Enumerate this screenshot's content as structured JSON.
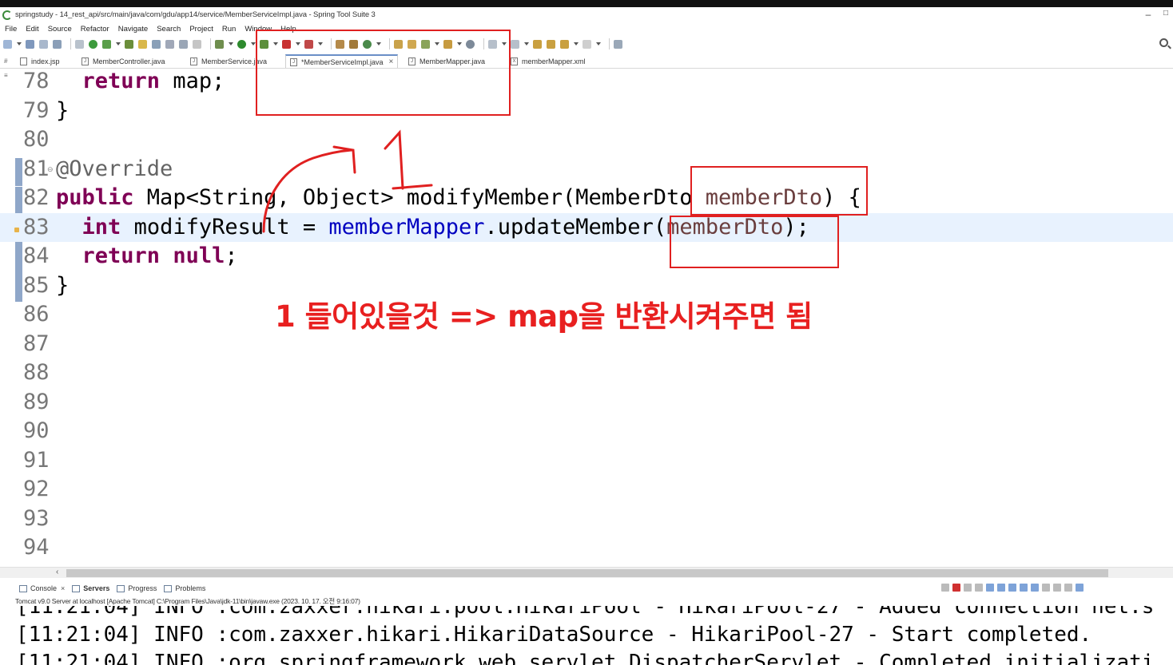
{
  "window": {
    "title": "springstudy - 14_rest_api/src/main/java/com/gdu/app14/service/MemberServiceImpl.java - Spring Tool Suite 3",
    "minimize": "–",
    "maximize": "□"
  },
  "menu": [
    "File",
    "Edit",
    "Source",
    "Refactor",
    "Navigate",
    "Search",
    "Project",
    "Run",
    "Window",
    "Help"
  ],
  "tabs": [
    {
      "label": "index.jsp",
      "icon": "jsp-file-icon"
    },
    {
      "label": "MemberController.java",
      "icon": "java-file-icon"
    },
    {
      "label": "MemberService.java",
      "icon": "java-file-icon"
    },
    {
      "label": "*MemberServiceImpl.java",
      "icon": "java-file-icon",
      "active": true,
      "close": "×"
    },
    {
      "label": "MemberMapper.java",
      "icon": "java-file-icon"
    },
    {
      "label": "memberMapper.xml",
      "icon": "xml-file-icon"
    }
  ],
  "editor": {
    "lines": [
      {
        "num": "78",
        "code": "  return map;"
      },
      {
        "num": "79",
        "code": "}"
      },
      {
        "num": "80",
        "code": ""
      },
      {
        "num": "81",
        "code": "@Override"
      },
      {
        "num": "82",
        "code": "public Map<String, Object> modifyMember(MemberDto memberDto) {"
      },
      {
        "num": "83",
        "code": "  int modifyResult = memberMapper.updateMember(memberDto);"
      },
      {
        "num": "84",
        "code": "  return null;"
      },
      {
        "num": "85",
        "code": "}"
      },
      {
        "num": "86",
        "code": ""
      },
      {
        "num": "87",
        "code": ""
      },
      {
        "num": "88",
        "code": ""
      },
      {
        "num": "89",
        "code": ""
      },
      {
        "num": "90",
        "code": ""
      },
      {
        "num": "91",
        "code": ""
      },
      {
        "num": "92",
        "code": ""
      },
      {
        "num": "93",
        "code": ""
      },
      {
        "num": "94",
        "code": ""
      }
    ],
    "current_line": "83",
    "annotation_text": "1 들어있을것 => map을 반환시켜주면 됨",
    "annotation_color": "#e82020"
  },
  "console_tabs": [
    {
      "label": "Console",
      "icon": "console-icon",
      "close": "×"
    },
    {
      "label": "Servers",
      "icon": "servers-icon"
    },
    {
      "label": "Progress",
      "icon": "progress-icon"
    },
    {
      "label": "Problems",
      "icon": "problems-icon"
    }
  ],
  "console": {
    "description": "Tomcat v9.0 Server at localhost [Apache Tomcat] C:\\Program Files\\Java\\jdk-11\\bin\\javaw.exe  (2023. 10. 17. 오전 9:16:07)",
    "lines": [
      "[11:21:04] INFO :com.zaxxer.hikari.pool.HikariPool - HikariPool-27 - Added connection net.s",
      "[11:21:04] INFO :com.zaxxer.hikari.HikariDataSource - HikariPool-27 - Start completed.",
      "[11:21:04] INFO :org.springframework.web.servlet.DispatcherServlet - Completed initializati"
    ]
  }
}
